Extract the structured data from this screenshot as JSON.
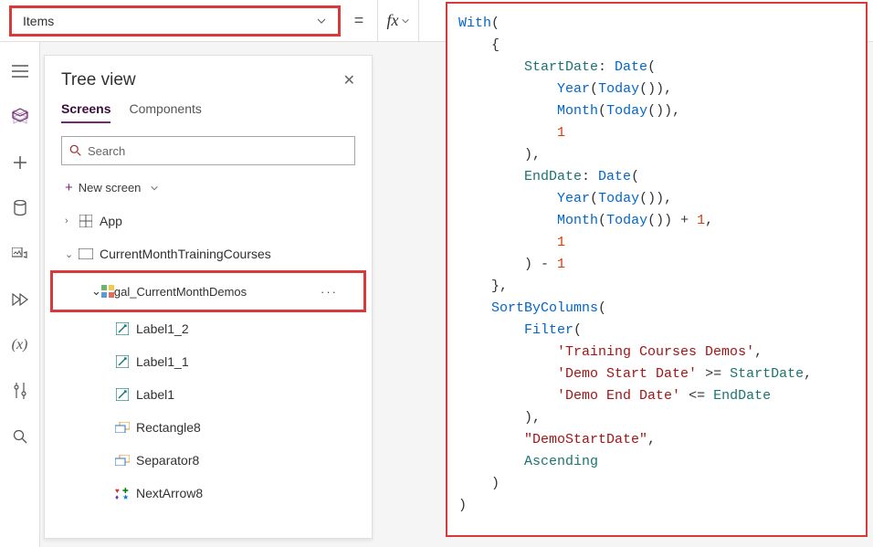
{
  "property": {
    "selected": "Items"
  },
  "fx_label": "fx",
  "tree": {
    "title": "Tree view",
    "tabs": {
      "screens": "Screens",
      "components": "Components"
    },
    "search_placeholder": "Search",
    "new_screen": "New screen",
    "app": "App",
    "screen1": "CurrentMonthTrainingCourses",
    "gallery": "gal_CurrentMonthDemos",
    "children": {
      "label12": "Label1_2",
      "label11": "Label1_1",
      "label1": "Label1",
      "rect": "Rectangle8",
      "sep": "Separator8",
      "next": "NextArrow8"
    }
  },
  "code": {
    "t_with": "With",
    "t_startdate": "StartDate",
    "t_enddate": "EndDate",
    "t_date": "Date",
    "t_year": "Year",
    "t_month": "Month",
    "t_today": "Today",
    "t_sort": "SortByColumns",
    "t_filter": "Filter",
    "t_asc": "Ascending",
    "n_one": "1",
    "s_courses": "'Training Courses Demos'",
    "s_start": "'Demo Start Date'",
    "s_end": "'Demo End Date'",
    "s_demostart": "\"DemoStartDate\""
  }
}
